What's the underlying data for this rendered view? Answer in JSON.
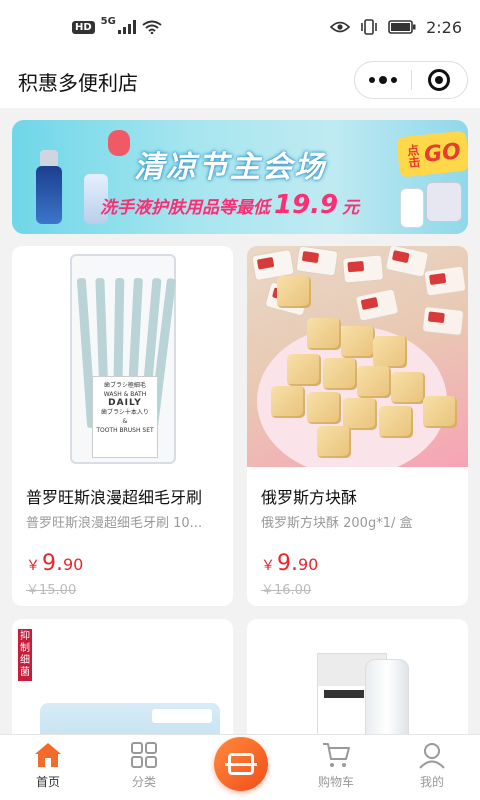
{
  "status_bar": {
    "hd": "HD",
    "network": "5G",
    "time": "2:26"
  },
  "header": {
    "title": "积惠多便利店"
  },
  "banner": {
    "title": "清凉节主会场",
    "subtitle": "洗手液护肤用品等最低",
    "price": "19.9",
    "price_unit": "元",
    "cta_small": "点击",
    "cta_go": "GO"
  },
  "products": [
    {
      "name": "普罗旺斯浪漫超细毛牙刷",
      "desc": "普罗旺斯浪漫超细毛牙刷 10...",
      "price_symbol": "￥",
      "price_int": "9.",
      "price_dec": "90",
      "original_price": "￥15.00"
    },
    {
      "name": "俄罗斯方块酥",
      "desc": "俄罗斯方块酥 200g*1/ 盒",
      "price_symbol": "￥",
      "price_int": "9.",
      "price_dec": "90",
      "original_price": "￥16.00"
    }
  ],
  "toothbrush_label": {
    "line1": "歯ブラシ極細毛",
    "line2": "WASH & BATH",
    "line3": "DAILY",
    "line4": "歯ブラシ十本入り",
    "line5": "&",
    "line6": "TOOTH BRUSH SET"
  },
  "card3_badge": "抑制细菌",
  "tabs": [
    {
      "label": "首页",
      "icon": "home-icon"
    },
    {
      "label": "分类",
      "icon": "grid-icon"
    },
    {
      "label": "",
      "icon": "scan-icon"
    },
    {
      "label": "购物车",
      "icon": "cart-icon"
    },
    {
      "label": "我的",
      "icon": "user-icon"
    }
  ],
  "colors": {
    "price": "#e8262b",
    "active_tab": "#f26b2a",
    "scan_button": "#f04e1a"
  }
}
